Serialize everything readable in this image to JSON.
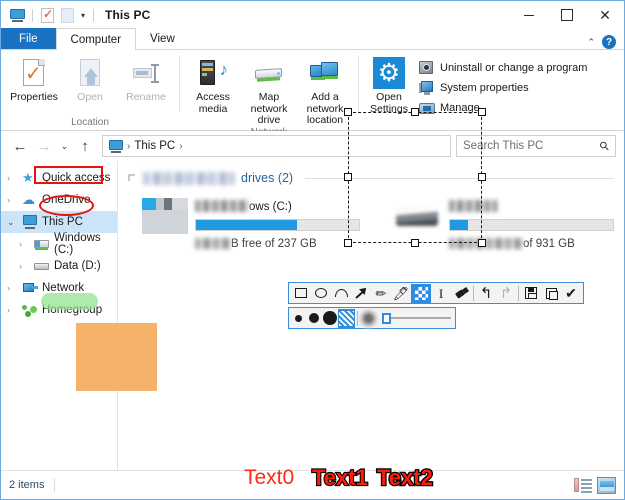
{
  "window": {
    "title": "This PC",
    "quick_access_icons": [
      "monitor-icon",
      "properties-icon",
      "blank-icon",
      "dropdown-caret"
    ],
    "controls": {
      "minimize": "—",
      "maximize": "□",
      "close": "✕"
    }
  },
  "tabs": [
    {
      "id": "file",
      "label": "File",
      "active": false,
      "style": "file"
    },
    {
      "id": "computer",
      "label": "Computer",
      "active": true,
      "style": "normal"
    },
    {
      "id": "view",
      "label": "View",
      "active": false,
      "style": "normal"
    }
  ],
  "tab_right": {
    "collapse_ribbon": "⌃",
    "help": "?"
  },
  "ribbon": {
    "groups": [
      {
        "label": "Location",
        "buttons": [
          {
            "label": "Properties",
            "icon": "properties-icon",
            "disabled": false
          },
          {
            "label": "Open",
            "icon": "open-icon",
            "disabled": true
          },
          {
            "label": "Rename",
            "icon": "rename-icon",
            "disabled": true
          }
        ]
      },
      {
        "label": "Network",
        "buttons": [
          {
            "label": "Access media",
            "icon": "access-media-icon",
            "disabled": false,
            "has_dropdown": true
          },
          {
            "label": "Map network drive",
            "icon": "map-network-drive-icon",
            "disabled": false,
            "has_dropdown": true
          },
          {
            "label": "Add a network location",
            "icon": "add-network-location-icon",
            "disabled": false,
            "has_dropdown": false
          }
        ]
      },
      {
        "label": "",
        "big_button": {
          "label_line1": "Open",
          "label_line2": "Settings",
          "icon": "gear-icon"
        },
        "menu": [
          {
            "label": "Uninstall or change a program",
            "icon": "uninstall-icon"
          },
          {
            "label": "System properties",
            "icon": "system-properties-icon"
          },
          {
            "label": "Manage",
            "icon": "manage-icon"
          }
        ]
      }
    ]
  },
  "addressbar": {
    "back": "←",
    "forward": "→",
    "recent": "⌄",
    "up": "↑",
    "breadcrumb": {
      "icon": "monitor-icon",
      "text": "This PC",
      "separator": "›"
    },
    "search": {
      "placeholder": "Search This PC",
      "icon": "search-icon"
    }
  },
  "navpane": {
    "items": [
      {
        "label": "Quick access",
        "icon": "star-icon",
        "indent": 0,
        "expander": "›",
        "selected": false
      },
      {
        "label": "OneDrive",
        "icon": "cloud-icon",
        "indent": 0,
        "expander": "›",
        "selected": false
      },
      {
        "label": "This PC",
        "icon": "computer-icon",
        "indent": 0,
        "expander": "⌄",
        "selected": true
      },
      {
        "label": "Windows (C:)",
        "icon": "hard-drive-icon",
        "indent": 1,
        "expander": "›",
        "selected": false
      },
      {
        "label": "Data (D:)",
        "icon": "hard-drive-icon",
        "indent": 1,
        "expander": "›",
        "selected": false
      },
      {
        "label": "Network",
        "icon": "network-icon",
        "indent": 0,
        "expander": "›",
        "selected": false
      },
      {
        "label": "Homegroup",
        "icon": "homegroup-icon",
        "indent": 0,
        "expander": "›",
        "selected": false
      }
    ]
  },
  "content": {
    "group_header": {
      "blurred_prefix": true,
      "text": "drives (2)"
    },
    "drives": [
      {
        "name_visible": "ows (C:)",
        "name_blurred": true,
        "free_text": "B free of 237 GB",
        "free_blurred_prefix": true,
        "bar_percent": 62,
        "icon_state": "mosaic-pixelated"
      },
      {
        "name_visible": "",
        "name_blurred": true,
        "free_text": "of 931 GB",
        "free_blurred_prefix": true,
        "bar_percent": 11,
        "icon_state": "blurred"
      }
    ]
  },
  "statusbar": {
    "item_count": "2 items",
    "view_buttons": [
      {
        "name": "details-view",
        "selected": false
      },
      {
        "name": "large-icons-view",
        "selected": true
      }
    ]
  },
  "annotations": {
    "shapes": [
      {
        "type": "rectangle",
        "color": "#e8120c",
        "target": "Quick access"
      },
      {
        "type": "ellipse",
        "color": "#e8120c",
        "target": "OneDrive"
      },
      {
        "type": "highlight",
        "color": "#8fe08f",
        "target": "Network"
      },
      {
        "type": "filled-rectangle",
        "color": "#f6b26b",
        "target": "Homegroup area"
      }
    ],
    "texts": [
      {
        "value": "Text0",
        "style": "plain",
        "color": "#ff2a1a"
      },
      {
        "value": "Text1",
        "style": "outlined",
        "color": "#ff1a0a",
        "outline": "#000000"
      },
      {
        "value": "Text2",
        "style": "outlined-bold",
        "color": "#ff1a0a",
        "outline": "#000000"
      }
    ],
    "selection": {
      "active": true,
      "handles": 8
    }
  },
  "anntoolbar": {
    "row1": [
      {
        "name": "rectangle-tool",
        "glyph": "rectangle",
        "active": false
      },
      {
        "name": "ellipse-tool",
        "glyph": "ellipse",
        "active": false
      },
      {
        "name": "arc-tool",
        "glyph": "arc",
        "active": false
      },
      {
        "name": "arrow-tool",
        "glyph": "arrow",
        "active": false
      },
      {
        "name": "pencil-tool",
        "glyph": "pencil",
        "active": false
      },
      {
        "name": "highlighter-tool",
        "glyph": "highlighter",
        "active": false
      },
      {
        "name": "mosaic-tool",
        "glyph": "mosaic",
        "active": true
      },
      {
        "name": "text-tool",
        "glyph": "ibeam",
        "active": false
      },
      {
        "name": "eraser-tool",
        "glyph": "eraser",
        "active": false
      },
      {
        "name": "undo-button",
        "glyph": "undo",
        "active": false,
        "disabled": false
      },
      {
        "name": "redo-button",
        "glyph": "redo",
        "active": false,
        "disabled": true
      },
      {
        "name": "save-button",
        "glyph": "floppy",
        "active": false
      },
      {
        "name": "copy-button",
        "glyph": "copy",
        "active": false
      },
      {
        "name": "confirm-button",
        "glyph": "check",
        "active": false
      }
    ],
    "row2": {
      "sizes": [
        {
          "name": "size-small",
          "diameter": 7,
          "active": false
        },
        {
          "name": "size-medium",
          "diameter": 10,
          "active": false
        },
        {
          "name": "size-large",
          "diameter": 14,
          "active": false
        }
      ],
      "pattern_swatch": {
        "name": "pattern-swatch",
        "active": true
      },
      "preview": {
        "name": "blur-preview"
      },
      "slider": {
        "name": "intensity-slider",
        "value": 4
      }
    }
  }
}
